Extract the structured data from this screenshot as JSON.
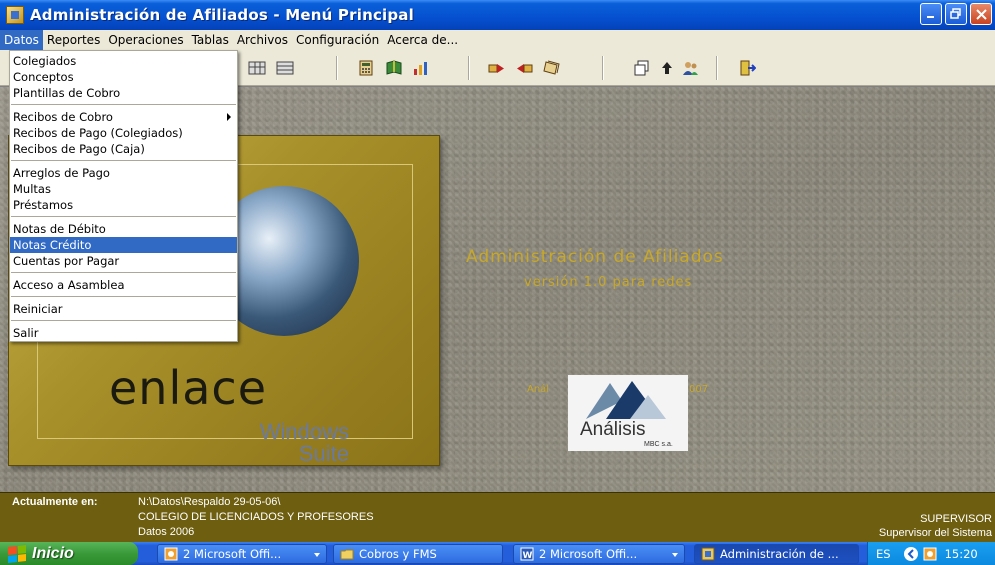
{
  "window": {
    "title": "Administración de Afiliados - Menú Principal"
  },
  "menubar": {
    "items": [
      "Datos",
      "Reportes",
      "Operaciones",
      "Tablas",
      "Archivos",
      "Configuración",
      "Acerca de..."
    ]
  },
  "dropdown": {
    "items": [
      {
        "label": "Colegiados"
      },
      {
        "label": "Conceptos"
      },
      {
        "label": "Plantillas de Cobro"
      },
      {
        "separator": true
      },
      {
        "label": "Recibos de Cobro",
        "submenu": true
      },
      {
        "label": "Recibos de Pago (Colegiados)"
      },
      {
        "label": "Recibos de Pago (Caja)"
      },
      {
        "separator": true
      },
      {
        "label": "Arreglos de Pago"
      },
      {
        "label": "Multas"
      },
      {
        "label": "Préstamos"
      },
      {
        "separator": true
      },
      {
        "label": "Notas de Débito"
      },
      {
        "label": "Notas Crédito",
        "highlighted": true
      },
      {
        "label": "Cuentas por Pagar"
      },
      {
        "separator": true
      },
      {
        "label": "Acceso a Asamblea"
      },
      {
        "separator": true
      },
      {
        "label": "Reiniciar"
      },
      {
        "separator": true
      },
      {
        "label": "Salir"
      }
    ]
  },
  "logo": {
    "word": "enlace",
    "windows_line1": "Windows",
    "windows_line2": "Suite"
  },
  "center": {
    "app_title": "Administración de Afiliados",
    "version": "versión 1.0 para redes",
    "copyright_left": "Anál",
    "copyright_right": "007"
  },
  "analisis_logo": {
    "name": "Análisis",
    "sub": "MBC s.a."
  },
  "status": {
    "label": "Actualmente en:",
    "path": "N:\\Datos\\Respaldo 29-05-06\\",
    "org": "COLEGIO DE LICENCIADOS Y PROFESORES",
    "dataset": "Datos 2006",
    "user": "SUPERVISOR",
    "role": "Supervisor del Sistema"
  },
  "taskbar": {
    "start_label": "Inicio",
    "buttons": [
      {
        "label": "2 Microsoft Offi...",
        "icon": "office-icon",
        "dropdown": true
      },
      {
        "label": "Cobros y FMS",
        "icon": "folder-icon"
      },
      {
        "label": "2 Microsoft Offi...",
        "icon": "word-icon",
        "dropdown": true
      },
      {
        "label": "Administración de ...",
        "icon": "app-icon",
        "active": true
      }
    ],
    "tray": {
      "lang": "ES",
      "time": "15:20"
    }
  },
  "colors": {
    "titlebar": "#0550d0",
    "menu_highlight": "#316ac5",
    "status_bg": "#6e5e10",
    "accent_gold": "#c8a828"
  }
}
